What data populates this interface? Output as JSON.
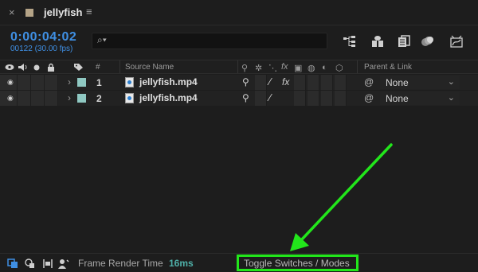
{
  "panel": {
    "close_glyph": "×",
    "comp_name": "jellyfish",
    "menu_glyph": "≡"
  },
  "time": {
    "timecode": "0:00:04:02",
    "frame_info": "00122 (30.00 fps)"
  },
  "search": {
    "icon_glyph": "⌕▾",
    "value": ""
  },
  "toolbar_icons": [
    "composition-flowchart-icon",
    "draft-3d-icon",
    "frame-blending-icon",
    "motion-blur-icon",
    "graph-editor-icon"
  ],
  "columns": {
    "number": "#",
    "source_name": "Source Name",
    "parent_link": "Parent & Link"
  },
  "layers": [
    {
      "number": "1",
      "name": "jellyfish.mp4",
      "shy": "⚲",
      "quality": "∕",
      "fx": "fx",
      "parent": "None",
      "label_color": "#8fc8c2"
    },
    {
      "number": "2",
      "name": "jellyfish.mp4",
      "shy": "⚲",
      "quality": "∕",
      "fx": "",
      "parent": "None",
      "label_color": "#8fc8c2"
    }
  ],
  "footer": {
    "frame_render_label": "Frame Render Time",
    "frame_render_value": "16ms",
    "toggle_label": "Toggle Switches / Modes"
  },
  "colors": {
    "timecode": "#3f8fe3",
    "render_time": "#4fb0a9",
    "highlight": "#22e61b"
  }
}
